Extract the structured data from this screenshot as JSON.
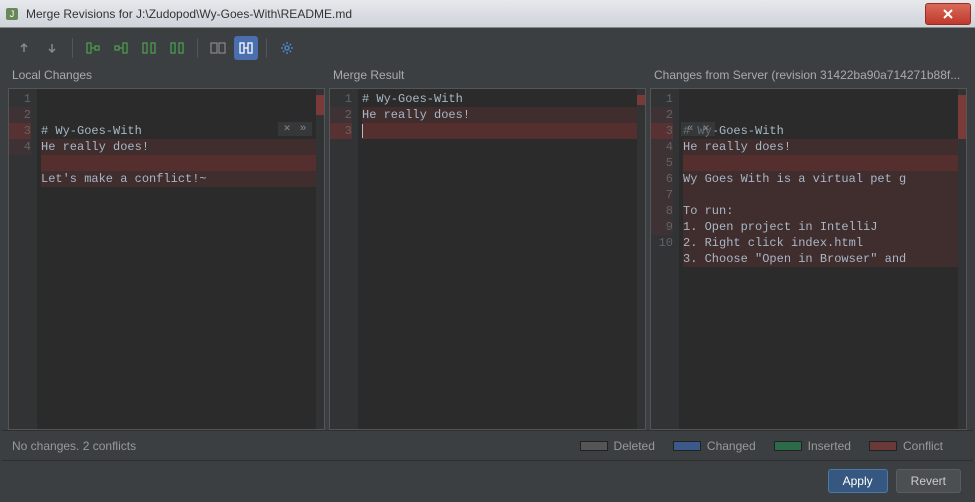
{
  "window": {
    "title": "Merge Revisions for J:\\Zudopod\\Wy-Goes-With\\README.md"
  },
  "toolbar": {
    "prev": "prev-change",
    "next": "next-change"
  },
  "panels": {
    "left": {
      "title": "Local Changes",
      "lines": [
        {
          "num": "1",
          "text": "# Wy-Goes-With",
          "cls": ""
        },
        {
          "num": "2",
          "text": "He really does!",
          "cls": "hl-conflict-light"
        },
        {
          "num": "3",
          "text": "",
          "cls": "hl-conflict-bg"
        },
        {
          "num": "4",
          "text": "Let's make a conflict!~",
          "cls": "hl-conflict-light"
        }
      ]
    },
    "middle": {
      "title": "Merge Result",
      "lines": [
        {
          "num": "1",
          "text": "# Wy-Goes-With",
          "cls": ""
        },
        {
          "num": "2",
          "text": "He really does!",
          "cls": "hl-conflict-light"
        },
        {
          "num": "3",
          "text": "",
          "cls": "hl-conflict-bg"
        }
      ]
    },
    "right": {
      "title": "Changes from Server (revision 31422ba90a714271b88f...",
      "lines": [
        {
          "num": "1",
          "text": "# Wy-Goes-With",
          "cls": ""
        },
        {
          "num": "2",
          "text": "He really does!",
          "cls": "hl-conflict-light"
        },
        {
          "num": "3",
          "text": "",
          "cls": "hl-conflict-bg"
        },
        {
          "num": "4",
          "text": "Wy Goes With is a virtual pet g",
          "cls": "hl-conflict-light"
        },
        {
          "num": "5",
          "text": "",
          "cls": "hl-conflict-light"
        },
        {
          "num": "6",
          "text": "To run:",
          "cls": "hl-conflict-light"
        },
        {
          "num": "7",
          "text": "1. Open project in IntelliJ",
          "cls": "hl-conflict-light"
        },
        {
          "num": "8",
          "text": "2. Right click index.html",
          "cls": "hl-conflict-light"
        },
        {
          "num": "9",
          "text": "3. Choose \"Open in Browser\" and",
          "cls": "hl-conflict-light"
        },
        {
          "num": "10",
          "text": "",
          "cls": ""
        }
      ]
    }
  },
  "status": {
    "summary": "No changes. 2 conflicts",
    "legend": {
      "deleted": "Deleted",
      "changed": "Changed",
      "inserted": "Inserted",
      "conflict": "Conflict"
    },
    "colors": {
      "deleted": "#555555",
      "changed": "#3a5a8a",
      "inserted": "#2d6a4a",
      "conflict": "#6a3a3a"
    }
  },
  "footer": {
    "apply": "Apply",
    "revert": "Revert"
  }
}
